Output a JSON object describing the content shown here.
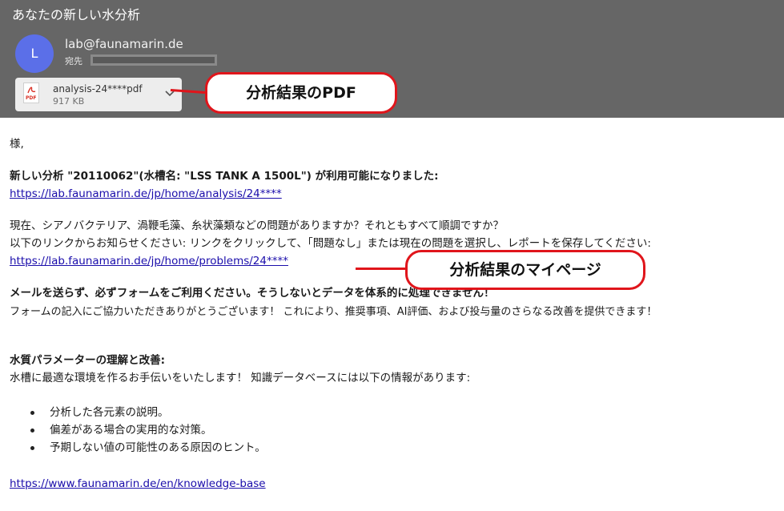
{
  "email": {
    "subject": "あなたの新しい水分析",
    "sender_initial": "L",
    "sender": "lab@faunamarin.de",
    "to_label": "宛先",
    "attachment": {
      "name": "analysis-24****pdf",
      "size": "917 KB",
      "icon": "pdf-icon",
      "icon_tag": "PDF"
    }
  },
  "callouts": {
    "pdf": "分析結果のPDF",
    "mypage": "分析結果のマイページ"
  },
  "body": {
    "greeting": "様,",
    "announcement": "新しい分析 \"20110062\"(水槽名: \"LSS TANK A 1500L\") が利用可能になりました:",
    "analysis_link": "https://lab.faunamarin.de/jp/home/analysis/24****",
    "question_line1": "現在、シアノバクテリア、渦鞭毛藻、糸状藻類などの問題がありますか？それともすべて順調ですか？",
    "question_line2": "以下のリンクからお知らせください: リンクをクリックして、「問題なし」または現在の問題を選択し、レポートを保存してください:",
    "problems_link": "https://lab.faunamarin.de/jp/home/problems/24****",
    "warning": "メールを送らず、必ずフォームをご利用ください。そうしないとデータを体系的に処理できません！",
    "thanks": "フォームの記入にご協力いただきありがとうございます！ これにより、推奨事項、AI評価、および投与量のさらなる改善を提供できます！",
    "section_title": "水質パラメーターの理解と改善:",
    "section_intro": "水槽に最適な環境を作るお手伝いをいたします！ 知識データベースには以下の情報があります:",
    "bullets": [
      "分析した各元素の説明。",
      "偏差がある場合の実用的な対策。",
      "予期しない値の可能性のある原因のヒント。"
    ],
    "kb_link": "https://www.faunamarin.de/en/knowledge-base"
  },
  "colors": {
    "header_bg": "#666666",
    "avatar": "#5b6fe8",
    "callout_border": "#e0151b",
    "link": "#1a0dab"
  }
}
